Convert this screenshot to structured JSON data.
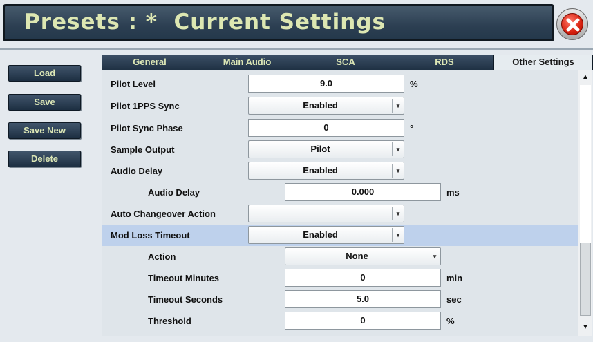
{
  "header": {
    "title": "Presets : *  Current Settings",
    "close_icon": "close-icon"
  },
  "sidebar": {
    "buttons": [
      {
        "label": "Load"
      },
      {
        "label": "Save"
      },
      {
        "label": "Save New"
      },
      {
        "label": "Delete"
      }
    ]
  },
  "tabs": [
    {
      "label": "General",
      "active": false
    },
    {
      "label": "Main Audio",
      "active": false
    },
    {
      "label": "SCA",
      "active": false
    },
    {
      "label": "RDS",
      "active": false
    },
    {
      "label": "Other Settings",
      "active": true
    }
  ],
  "settings": {
    "pilot_level": {
      "label": "Pilot Level",
      "value": "9.0",
      "unit": "%"
    },
    "pilot_1pps_sync": {
      "label": "Pilot 1PPS Sync",
      "value": "Enabled"
    },
    "pilot_sync_phase": {
      "label": "Pilot Sync Phase",
      "value": "0",
      "unit": "°"
    },
    "sample_output": {
      "label": "Sample Output",
      "value": "Pilot"
    },
    "audio_delay_enable": {
      "label": "Audio Delay",
      "value": "Enabled"
    },
    "audio_delay_value": {
      "label": "Audio Delay",
      "value": "0.000",
      "unit": "ms"
    },
    "auto_changeover_action": {
      "label": "Auto Changeover Action",
      "value": ""
    },
    "mod_loss_timeout": {
      "label": "Mod Loss Timeout",
      "value": "Enabled"
    },
    "action": {
      "label": "Action",
      "value": "None"
    },
    "timeout_minutes": {
      "label": "Timeout Minutes",
      "value": "0",
      "unit": "min"
    },
    "timeout_seconds": {
      "label": "Timeout Seconds",
      "value": "5.0",
      "unit": "sec"
    },
    "threshold": {
      "label": "Threshold",
      "value": "0",
      "unit": "%"
    }
  },
  "scrollbar": {
    "up_icon": "scroll-up-arrow-icon",
    "down_icon": "scroll-down-arrow-icon"
  },
  "colors": {
    "header_bg": "#2c3f52",
    "header_text": "#dde7b2",
    "highlight_row": "#bed1ec",
    "close_red": "#d8210f"
  }
}
